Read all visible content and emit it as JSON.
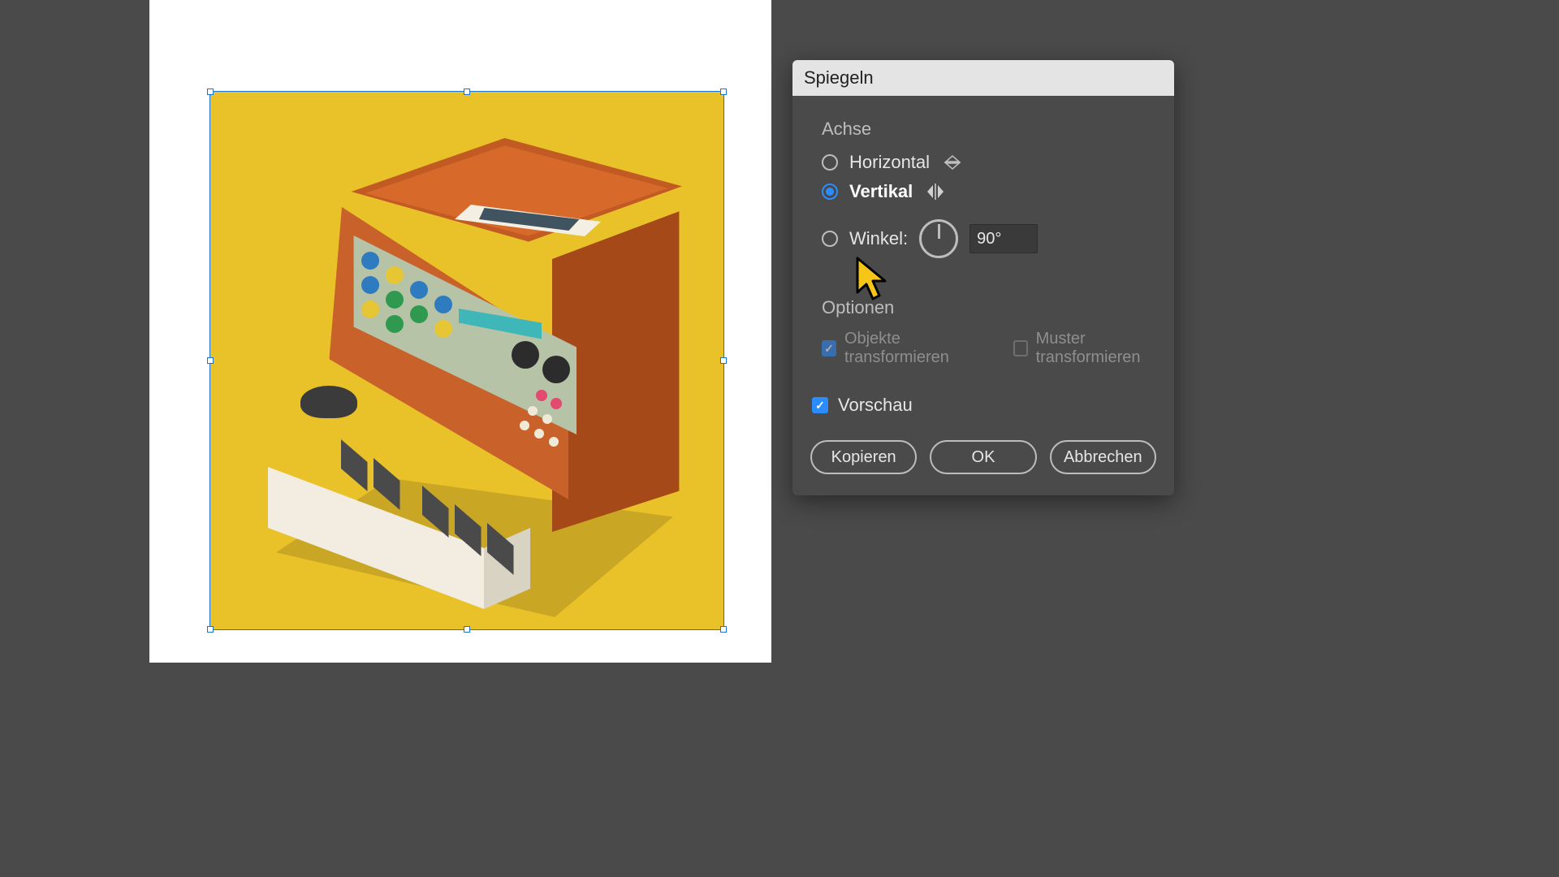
{
  "dialog": {
    "title": "Spiegeln",
    "axis_section": "Achse",
    "horizontal_label": "Horizontal",
    "vertical_label": "Vertikal",
    "angle_label": "Winkel:",
    "angle_value": "90°",
    "axis_selected": "vertical",
    "options_section": "Optionen",
    "transform_objects_label": "Objekte transformieren",
    "transform_objects_checked": true,
    "transform_patterns_label": "Muster transformieren",
    "transform_patterns_checked": false,
    "preview_label": "Vorschau",
    "preview_checked": true,
    "buttons": {
      "copy": "Kopieren",
      "ok": "OK",
      "cancel": "Abbrechen"
    }
  },
  "artwork": {
    "bg_color": "#e9c229"
  }
}
